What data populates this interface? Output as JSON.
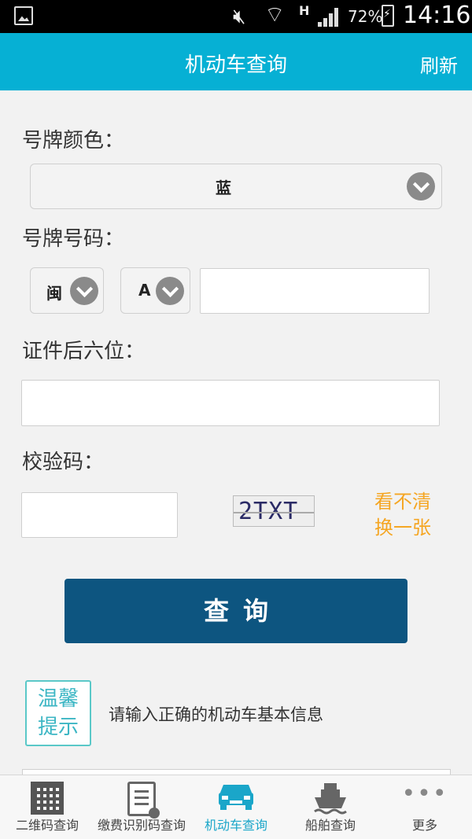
{
  "status_bar": {
    "network_type": "H",
    "battery_percent": "72%",
    "time": "14:16"
  },
  "header": {
    "title": "机动车查询",
    "refresh_label": "刷新"
  },
  "form": {
    "plate_color_label": "号牌颜色：",
    "plate_color_value": "蓝",
    "plate_number_label": "号牌号码：",
    "province_value": "闽",
    "letter_value": "A",
    "plate_number_value": "",
    "cert_label": "证件后六位：",
    "cert_value": "",
    "captcha_label": "校验码：",
    "captcha_value": "",
    "captcha_image_text": "2TXT",
    "captcha_refresh_line1": "看不清",
    "captcha_refresh_line2": "换一张",
    "submit_label": "查询"
  },
  "tip": {
    "badge_line1": "温馨",
    "badge_line2": "提示",
    "text": "请输入正确的机动车基本信息"
  },
  "tabs": [
    {
      "label": "二维码查询",
      "icon": "qr-code-icon",
      "active": false
    },
    {
      "label": "缴费识别码查询",
      "icon": "document-icon",
      "active": false
    },
    {
      "label": "机动车查询",
      "icon": "car-icon",
      "active": true
    },
    {
      "label": "船舶查询",
      "icon": "ship-icon",
      "active": false
    },
    {
      "label": "更多",
      "icon": "more-icon",
      "active": false
    }
  ],
  "colors": {
    "header": "#06b0d4",
    "button": "#0d5580",
    "accent_orange": "#f5a623",
    "active_tab": "#1aa6c9"
  }
}
